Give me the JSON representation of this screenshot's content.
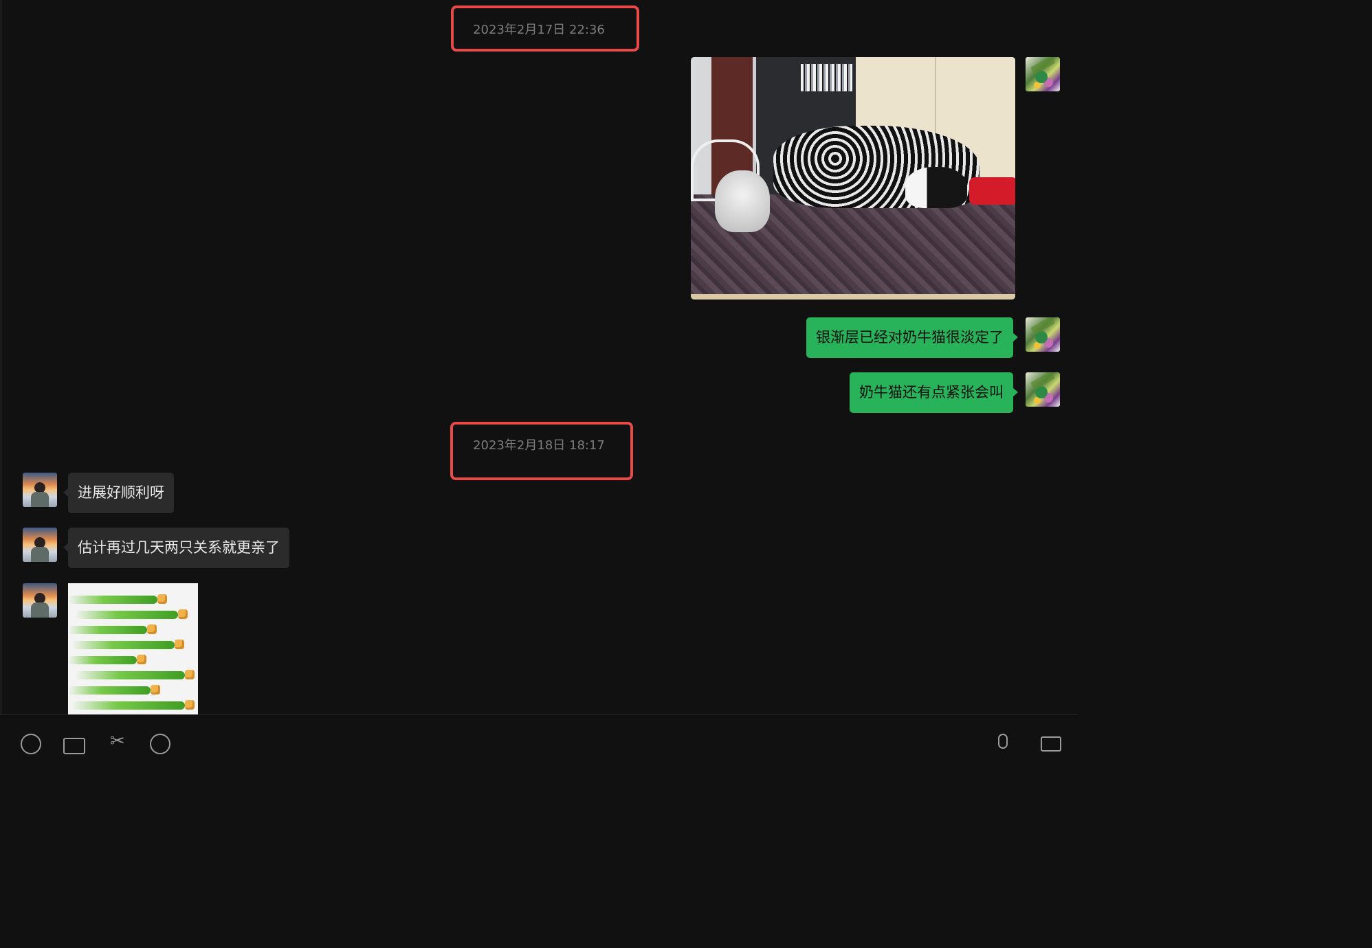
{
  "conversation": {
    "timestamps": [
      "2023年2月17日 22:36",
      "2023年2月18日 18:17"
    ],
    "messages": [
      {
        "sender": "self",
        "kind": "image",
        "content": "photo: two cats on a bed"
      },
      {
        "sender": "self",
        "kind": "text",
        "text": "银渐层已经对奶牛猫很淡定了"
      },
      {
        "sender": "self",
        "kind": "text",
        "text": "奶牛猫还有点紧张会叫"
      },
      {
        "sender": "other",
        "kind": "text",
        "text": "进展好顺利呀"
      },
      {
        "sender": "other",
        "kind": "text",
        "text": "估计再过几天两只关系就更亲了"
      },
      {
        "sender": "other",
        "kind": "image",
        "content": "sticker: rows of green arms giving thumbs-up"
      }
    ]
  },
  "highlight_color": "#e84a4a",
  "colors": {
    "background": "#111111",
    "outgoing_bubble": "#28b25a",
    "incoming_bubble": "#2b2b2b",
    "timestamp_text": "#7d7d7d"
  },
  "toolbar": {
    "icons": [
      "emoji-icon",
      "folder-icon",
      "scissors-icon",
      "chat-history-icon",
      "microphone-icon",
      "video-call-icon"
    ]
  }
}
